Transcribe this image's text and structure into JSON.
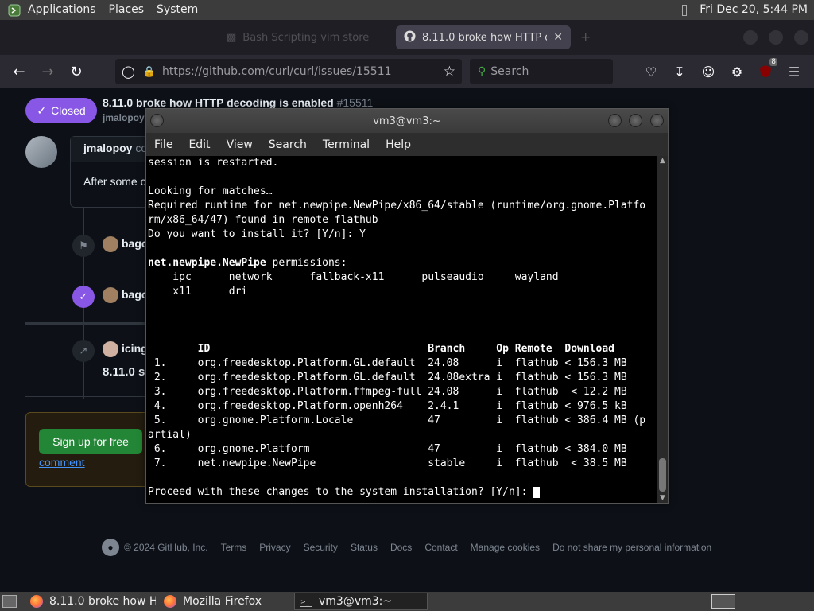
{
  "top_panel": {
    "menus": [
      "Applications",
      "Places",
      "System"
    ],
    "clock": "Fri Dec 20,  5:44 PM"
  },
  "browser": {
    "tabs": [
      {
        "label": "Bash Scripting  vim  store",
        "active": false
      },
      {
        "label": "8.11.0 broke how HTTP dec",
        "active": true
      }
    ],
    "url_base": "https://github.com",
    "url_path": "/curl/curl/issues/15511",
    "search_placeholder": "Search",
    "extension_badge": "8"
  },
  "github": {
    "status_badge": "Closed",
    "issue_title": "8.11.0 broke how HTTP decoding is enabled",
    "issue_number": "#15511",
    "issue_author": "jmalopoy",
    "comment_author": "jmalopoy",
    "comment_suffix": "co",
    "comment_body": "After some c",
    "timeline": [
      {
        "user": "bago",
        "icon": "tag-icon"
      },
      {
        "user": "bago",
        "icon": "check-circle-icon"
      },
      {
        "user": "icing",
        "icon": "cross-reference-icon",
        "subtitle": "8.11.0 s"
      }
    ],
    "signup_button": "Sign up for free",
    "comment_link": "comment",
    "footer": {
      "copyright": "© 2024 GitHub, Inc.",
      "links": [
        "Terms",
        "Privacy",
        "Security",
        "Status",
        "Docs",
        "Contact",
        "Manage cookies",
        "Do not share my personal information"
      ]
    }
  },
  "terminal": {
    "title": "vm3@vm3:~",
    "menus": [
      "File",
      "Edit",
      "View",
      "Search",
      "Terminal",
      "Help"
    ],
    "lines": [
      "session is restarted.",
      "",
      "Looking for matches…",
      "Required runtime for net.newpipe.NewPipe/x86_64/stable (runtime/org.gnome.Platfo",
      "rm/x86_64/47) found in remote flathub",
      "Do you want to install it? [Y/n]: Y",
      "",
      "net.newpipe.NewPipe permissions:",
      "    ipc      network      fallback-x11      pulseaudio     wayland",
      "    x11      dri",
      "",
      "",
      "",
      "        ID                                   Branch     Op Remote  Download",
      " 1.     org.freedesktop.Platform.GL.default  24.08      i  flathub < 156.3 MB",
      " 2.     org.freedesktop.Platform.GL.default  24.08extra i  flathub < 156.3 MB",
      " 3.     org.freedesktop.Platform.ffmpeg-full 24.08      i  flathub  < 12.2 MB",
      " 4.     org.freedesktop.Platform.openh264    2.4.1      i  flathub < 976.5 kB",
      " 5.     org.gnome.Platform.Locale            47         i  flathub < 386.4 MB (p",
      "artial)",
      " 6.     org.gnome.Platform                   47         i  flathub < 384.0 MB",
      " 7.     net.newpipe.NewPipe                  stable     i  flathub  < 38.5 MB",
      "",
      "Proceed with these changes to the system installation? [Y/n]: "
    ],
    "bold_lines": [
      7,
      13
    ]
  },
  "taskbar": {
    "tasks": [
      "8.11.0 broke how H…",
      "Mozilla Firefox",
      "vm3@vm3:~"
    ]
  }
}
